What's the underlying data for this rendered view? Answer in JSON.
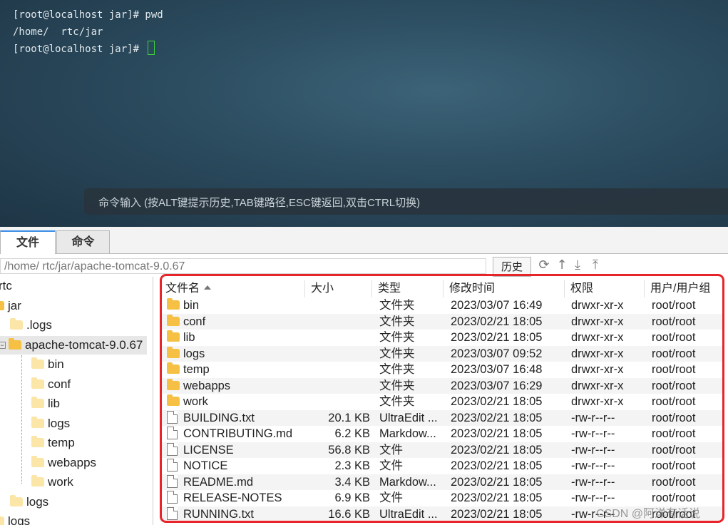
{
  "terminal": {
    "lines": [
      "[root@localhost jar]# pwd",
      "/home/  rtc/jar",
      "[root@localhost jar]# "
    ],
    "cmd_hint": "命令输入 (按ALT键提示历史,TAB键路径,ESC键返回,双击CTRL切换)"
  },
  "tabs": {
    "files": "文件",
    "commands": "命令"
  },
  "path_bar": {
    "path": "/home/ rtc/jar/apache-tomcat-9.0.67",
    "history": "历史"
  },
  "tree": {
    "items": [
      "rtc",
      "jar",
      ".logs",
      "apache-tomcat-9.0.67",
      "bin",
      "conf",
      "lib",
      "logs",
      "temp",
      "webapps",
      "work",
      "logs",
      "logs"
    ]
  },
  "columns": [
    "文件名",
    "大小",
    "类型",
    "修改时间",
    "权限",
    "用户/用户组"
  ],
  "files": [
    {
      "name": "bin",
      "size": "",
      "type": "文件夹",
      "mtime": "2023/03/07 16:49",
      "perm": "drwxr-xr-x",
      "owner": "root/root",
      "kind": "folder"
    },
    {
      "name": "conf",
      "size": "",
      "type": "文件夹",
      "mtime": "2023/02/21 18:05",
      "perm": "drwxr-xr-x",
      "owner": "root/root",
      "kind": "folder"
    },
    {
      "name": "lib",
      "size": "",
      "type": "文件夹",
      "mtime": "2023/02/21 18:05",
      "perm": "drwxr-xr-x",
      "owner": "root/root",
      "kind": "folder"
    },
    {
      "name": "logs",
      "size": "",
      "type": "文件夹",
      "mtime": "2023/03/07 09:52",
      "perm": "drwxr-xr-x",
      "owner": "root/root",
      "kind": "folder"
    },
    {
      "name": "temp",
      "size": "",
      "type": "文件夹",
      "mtime": "2023/03/07 16:48",
      "perm": "drwxr-xr-x",
      "owner": "root/root",
      "kind": "folder"
    },
    {
      "name": "webapps",
      "size": "",
      "type": "文件夹",
      "mtime": "2023/03/07 16:29",
      "perm": "drwxr-xr-x",
      "owner": "root/root",
      "kind": "folder"
    },
    {
      "name": "work",
      "size": "",
      "type": "文件夹",
      "mtime": "2023/02/21 18:05",
      "perm": "drwxr-xr-x",
      "owner": "root/root",
      "kind": "folder"
    },
    {
      "name": "BUILDING.txt",
      "size": "20.1 KB",
      "type": "UltraEdit ...",
      "mtime": "2023/02/21 18:05",
      "perm": "-rw-r--r--",
      "owner": "root/root",
      "kind": "file"
    },
    {
      "name": "CONTRIBUTING.md",
      "size": "6.2 KB",
      "type": "Markdow...",
      "mtime": "2023/02/21 18:05",
      "perm": "-rw-r--r--",
      "owner": "root/root",
      "kind": "file"
    },
    {
      "name": "LICENSE",
      "size": "56.8 KB",
      "type": "文件",
      "mtime": "2023/02/21 18:05",
      "perm": "-rw-r--r--",
      "owner": "root/root",
      "kind": "file"
    },
    {
      "name": "NOTICE",
      "size": "2.3 KB",
      "type": "文件",
      "mtime": "2023/02/21 18:05",
      "perm": "-rw-r--r--",
      "owner": "root/root",
      "kind": "file"
    },
    {
      "name": "README.md",
      "size": "3.4 KB",
      "type": "Markdow...",
      "mtime": "2023/02/21 18:05",
      "perm": "-rw-r--r--",
      "owner": "root/root",
      "kind": "file"
    },
    {
      "name": "RELEASE-NOTES",
      "size": "6.9 KB",
      "type": "文件",
      "mtime": "2023/02/21 18:05",
      "perm": "-rw-r--r--",
      "owner": "root/root",
      "kind": "file"
    },
    {
      "name": "RUNNING.txt",
      "size": "16.6 KB",
      "type": "UltraEdit ...",
      "mtime": "2023/02/21 18:05",
      "perm": "-rw-r--r--",
      "owner": "root/root",
      "kind": "file"
    }
  ],
  "watermark": "CSDN @阿洋有话说",
  "colors": {
    "frame": "#e8232a",
    "folder": "#f5c043",
    "cursor": "#3fd13f"
  }
}
